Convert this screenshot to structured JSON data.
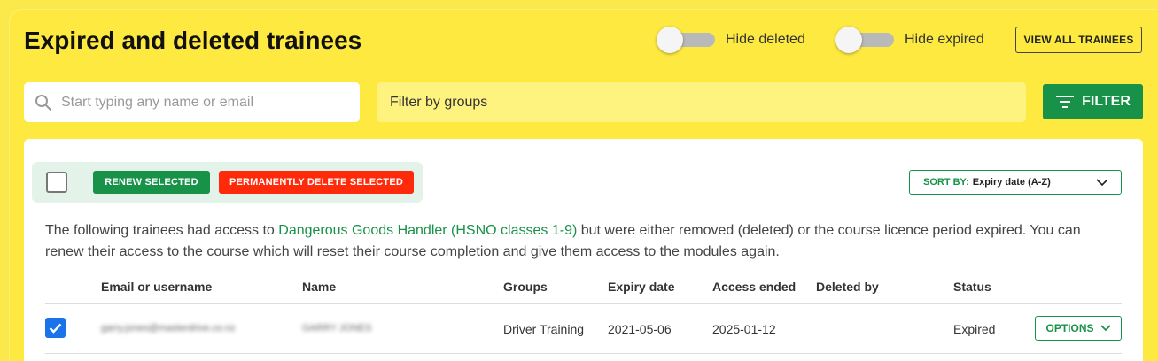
{
  "header": {
    "title": "Expired and deleted trainees",
    "toggles": [
      {
        "label": "Hide deleted",
        "on": false
      },
      {
        "label": "Hide expired",
        "on": false
      }
    ],
    "view_all_label": "VIEW ALL TRAINEES"
  },
  "filters": {
    "search_placeholder": "Start typing any name or email",
    "groups_placeholder": "Filter by groups",
    "filter_label": "FILTER"
  },
  "bulk": {
    "renew_label": "RENEW SELECTED",
    "delete_label": "PERMANENTLY DELETE SELECTED"
  },
  "sort": {
    "prefix": "SORT BY:",
    "value": "Expiry date (A-Z)"
  },
  "description": {
    "before": "The following trainees had access to ",
    "course": "Dangerous Goods Handler (HSNO classes 1-9)",
    "after": " but were either removed (deleted) or the course licence period expired. You can renew their access to the course which will reset their course completion and give them access to the modules again."
  },
  "table": {
    "columns": [
      "Email or username",
      "Name",
      "Groups",
      "Expiry date",
      "Access ended",
      "Deleted by",
      "Status"
    ],
    "rows": [
      {
        "selected": true,
        "email": "garry.jones@masterdrive.co.nz",
        "name": "GARRY JONES",
        "groups": "Driver Training",
        "expiry_date": "2021-05-06",
        "access_ended": "2025-01-12",
        "deleted_by": "",
        "status": "Expired",
        "options_label": "OPTIONS"
      }
    ]
  },
  "colors": {
    "background": "#fde93f",
    "accent_green": "#179248",
    "danger_red": "#ff2a0a",
    "checkbox_blue": "#1a73e8"
  }
}
